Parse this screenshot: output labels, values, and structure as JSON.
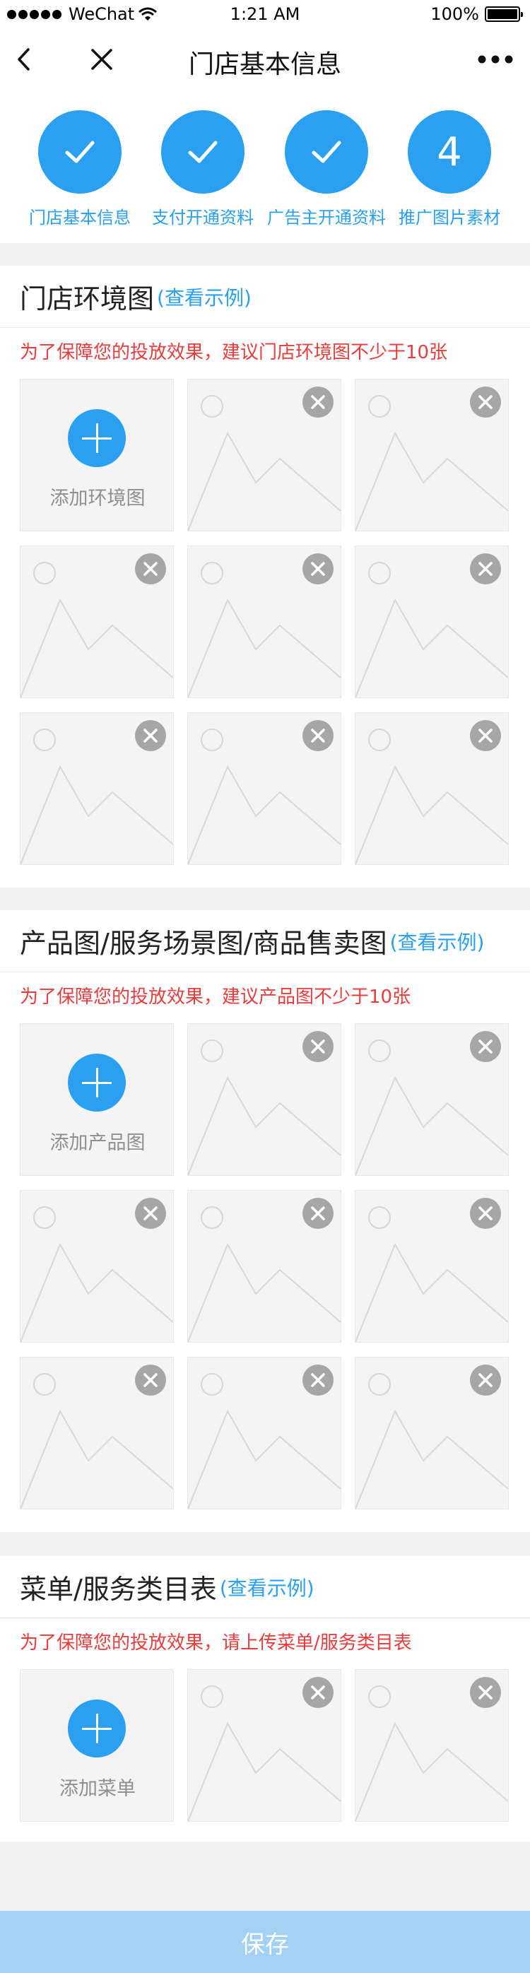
{
  "status_bar": {
    "carrier": "WeChat",
    "time": "1:21 AM",
    "battery": "100%"
  },
  "nav": {
    "title": "门店基本信息"
  },
  "steps": [
    {
      "label": "门店基本信息",
      "state": "done",
      "text": ""
    },
    {
      "label": "支付开通资料",
      "state": "done",
      "text": ""
    },
    {
      "label": "广告主开通资料",
      "state": "done",
      "text": ""
    },
    {
      "label": "推广图片素材",
      "state": "current",
      "text": "4"
    }
  ],
  "sections": [
    {
      "title": "门店环境图",
      "example": "(查看示例)",
      "hint": "为了保障您的投放效果，建议门店环境图不少于10张",
      "add_label": "添加环境图",
      "image_count": 8
    },
    {
      "title": "产品图/服务场景图/商品售卖图",
      "example": "(查看示例)",
      "hint": "为了保障您的投放效果，建议产品图不少于10张",
      "add_label": "添加产品图",
      "image_count": 8
    },
    {
      "title": "菜单/服务类目表",
      "example": "(查看示例)",
      "hint": "为了保障您的投放效果，请上传菜单/服务类目表",
      "add_label": "添加菜单",
      "image_count": 2
    }
  ],
  "save_label": "保存",
  "colors": {
    "accent": "#2b9ff0",
    "hint": "#e83d3d",
    "save_disabled": "#a3d1f4"
  }
}
